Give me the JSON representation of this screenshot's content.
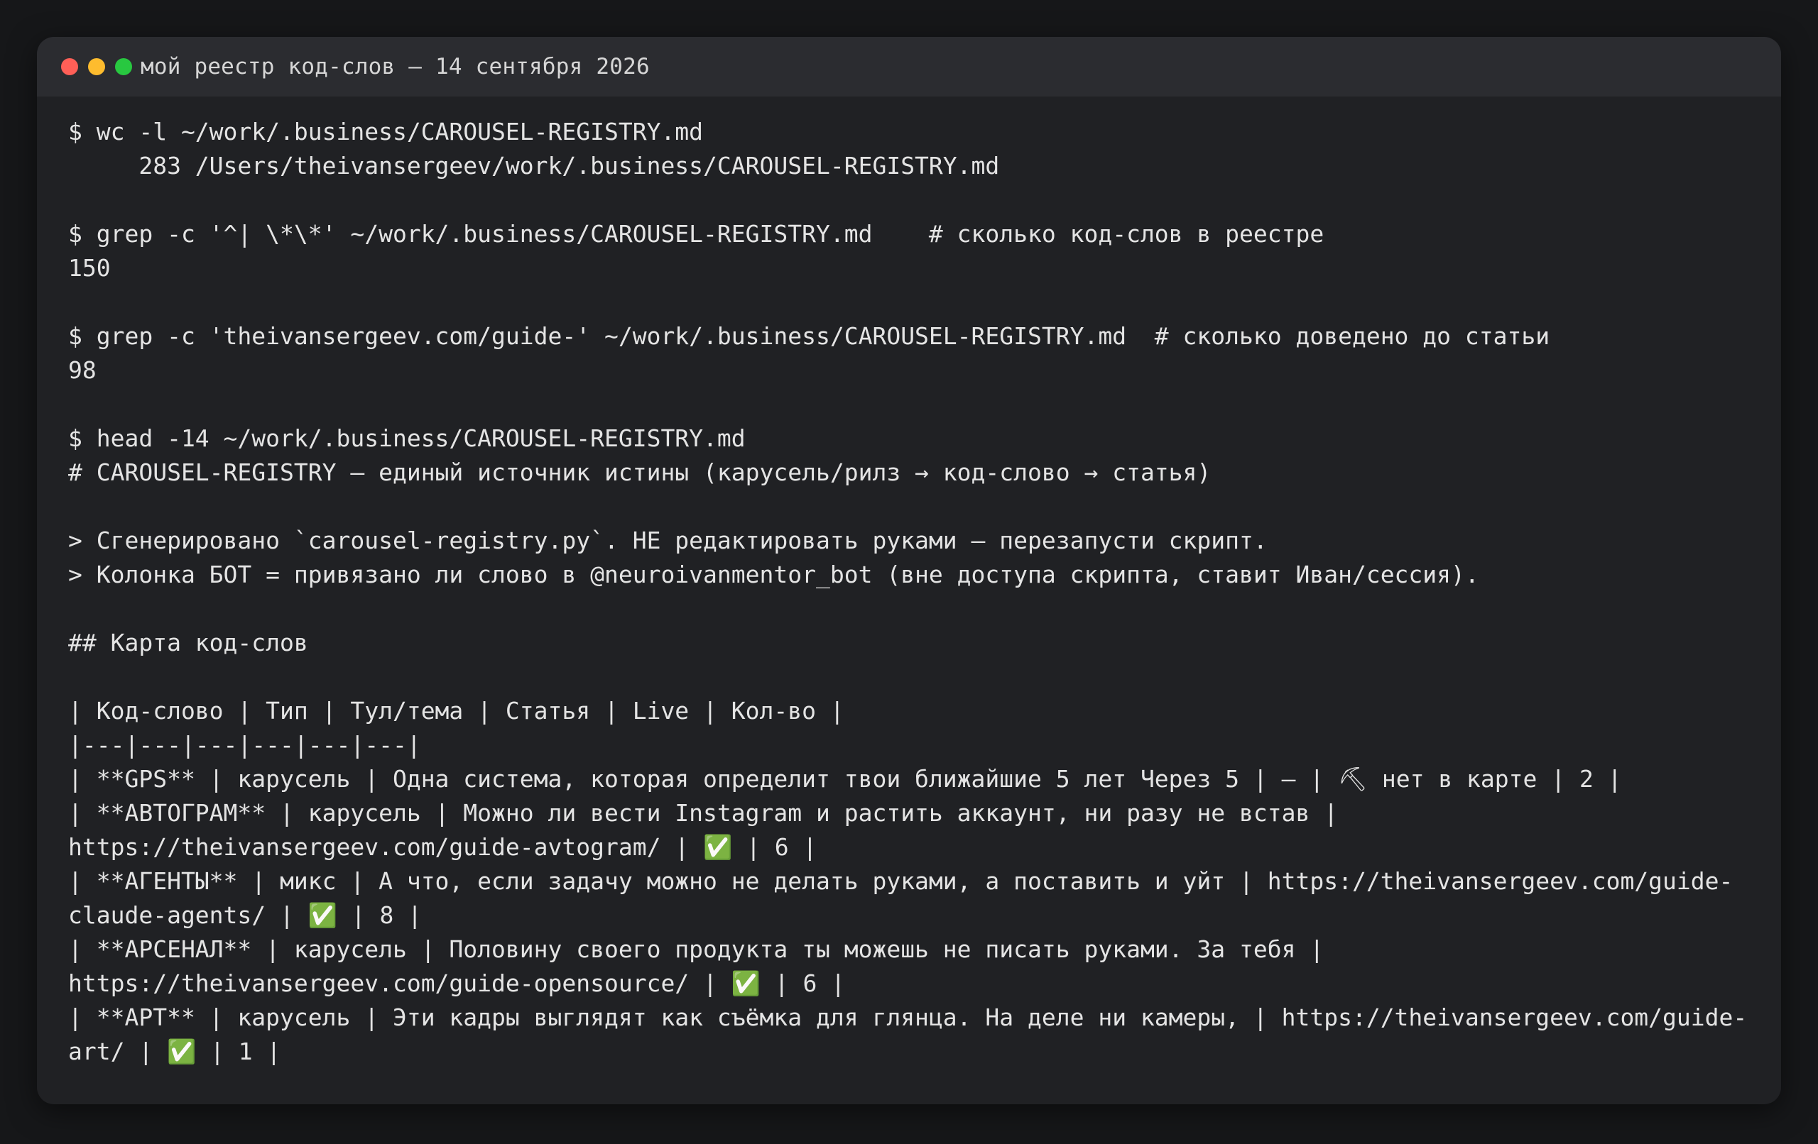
{
  "window": {
    "title": "мой реестр код-слов — 14 сентября 2026"
  },
  "terminal": {
    "lines": [
      {
        "text": "$ wc -l ~/work/.business/CAROUSEL-REGISTRY.md"
      },
      {
        "text": "     283 /Users/theivansergeev/work/.business/CAROUSEL-REGISTRY.md"
      },
      {
        "text": ""
      },
      {
        "text": "$ grep -c '^| \\*\\*' ~/work/.business/CAROUSEL-REGISTRY.md    # сколько код-слов в реестре"
      },
      {
        "text": "150"
      },
      {
        "text": ""
      },
      {
        "text": "$ grep -c 'theivansergeev.com/guide-' ~/work/.business/CAROUSEL-REGISTRY.md  # сколько доведено до статьи"
      },
      {
        "text": "98"
      },
      {
        "text": ""
      },
      {
        "text": "$ head -14 ~/work/.business/CAROUSEL-REGISTRY.md"
      },
      {
        "text": "# CAROUSEL-REGISTRY — единый источник истины (карусель/рилз → код-слово → статья)"
      },
      {
        "text": ""
      },
      {
        "text": "> Сгенерировано `carousel-registry.py`. НЕ редактировать руками — перезапусти скрипт."
      },
      {
        "text": "> Колонка БОТ = привязано ли слово в @neuroivanmentor_bot (вне доступа скрипта, ставит Иван/сессия)."
      },
      {
        "text": ""
      },
      {
        "text": "## Карта код-слов"
      },
      {
        "text": ""
      },
      {
        "text": "| Код-слово | Тип | Тул/тема | Статья | Live | Кол-во |"
      },
      {
        "text": "|---|---|---|---|---|---|"
      },
      {
        "text": "| **GPS** | карусель | Одна система, которая определит твои ближайшие 5 лет Через 5 | — | ⛏ нет в карте | 2 |"
      },
      {
        "text": "| **АВТОГРАМ** | карусель | Можно ли вести Instagram и растить аккаунт, ни разу не встав |"
      },
      {
        "text": "https://theivansergeev.com/guide-avtogram/ | ✅ | 6 |"
      },
      {
        "text": "| **АГЕНТЫ** | микс | А что, если задачу можно не делать руками, а поставить и уйт | https://theivansergeev.com/guide-"
      },
      {
        "text": "claude-agents/ | ✅ | 8 |"
      },
      {
        "text": "| **АРСЕНАЛ** | карусель | Половину своего продукта ты можешь не писать руками. За тебя |"
      },
      {
        "text": "https://theivansergeev.com/guide-opensource/ | ✅ | 6 |"
      },
      {
        "text": "| **АРТ** | карусель | Эти кадры выглядят как съёмка для глянца. На деле ни камеры, | https://theivansergeev.com/guide-"
      },
      {
        "text": "art/ | ✅ | 1 |"
      }
    ]
  },
  "colors": {
    "background": "#161719",
    "window": "#202124",
    "titlebar": "#2b2c30",
    "text": "#e4e4e4",
    "close": "#ff5f57",
    "minimize": "#febc2e",
    "zoom": "#28c840"
  }
}
